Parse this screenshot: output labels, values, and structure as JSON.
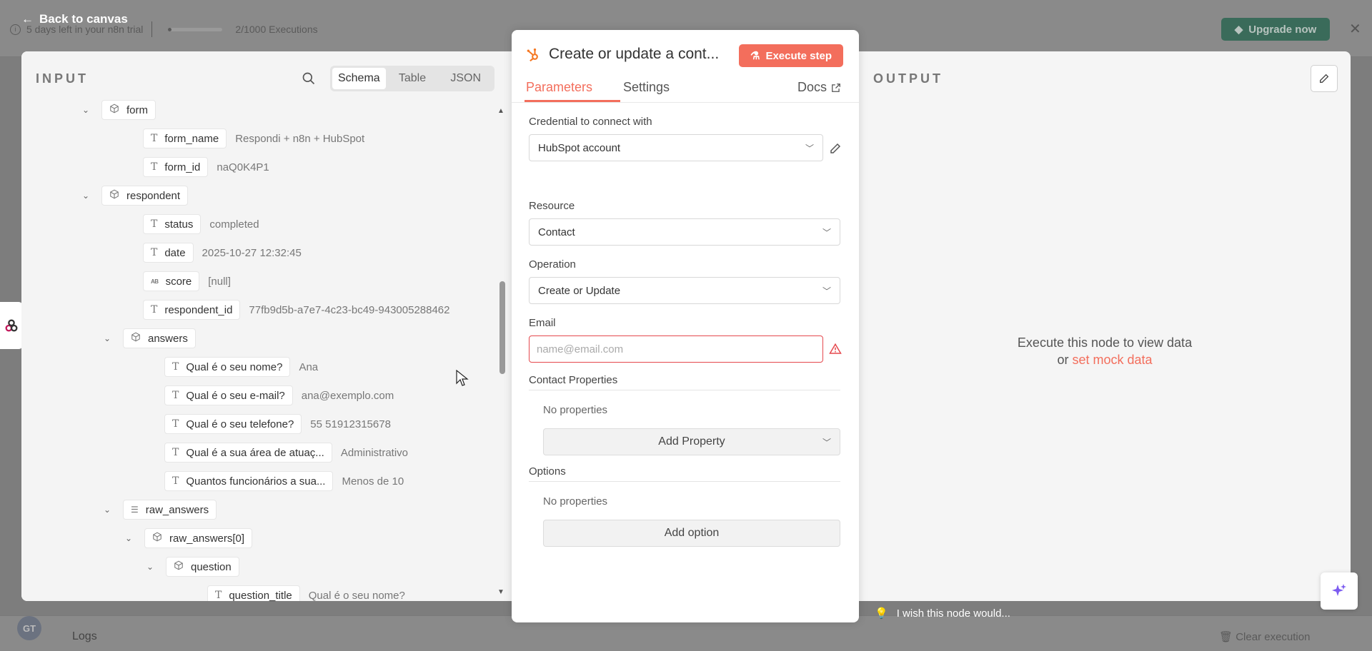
{
  "trial": {
    "text": "5 days left in your n8n trial",
    "executions": "2/1000 Executions",
    "progress": 0.002
  },
  "header": {
    "back_label": "Back to canvas",
    "upgrade_label": "Upgrade now"
  },
  "input_panel": {
    "title": "INPUT",
    "views": [
      "Schema",
      "Table",
      "JSON"
    ],
    "active_view": "Schema",
    "tree": [
      {
        "key": "form",
        "type": "object",
        "depth": 0,
        "expanded": true
      },
      {
        "key": "form_name",
        "type": "string",
        "depth": 1,
        "value": "Respondi + n8n + HubSpot"
      },
      {
        "key": "form_id",
        "type": "string",
        "depth": 1,
        "value": "naQ0K4P1"
      },
      {
        "key": "respondent",
        "type": "object",
        "depth": 0,
        "expanded": true
      },
      {
        "key": "status",
        "type": "string",
        "depth": 1,
        "value": "completed"
      },
      {
        "key": "date",
        "type": "string",
        "depth": 1,
        "value": "2025-10-27 12:32:45"
      },
      {
        "key": "score",
        "type": "null",
        "depth": 1,
        "value": "[null]"
      },
      {
        "key": "respondent_id",
        "type": "string",
        "depth": 1,
        "value": "77fb9d5b-a7e7-4c23-bc49-943005288462"
      },
      {
        "key": "answers",
        "type": "object",
        "depth": 1,
        "expanded": true
      },
      {
        "key": "Qual é o seu nome?",
        "type": "string",
        "depth": 2,
        "value": "Ana"
      },
      {
        "key": "Qual é o seu e-mail?",
        "type": "string",
        "depth": 2,
        "value": "ana@exemplo.com"
      },
      {
        "key": "Qual é o seu telefone?",
        "type": "string",
        "depth": 2,
        "value": "55 51912315678"
      },
      {
        "key": "Qual é a sua área de atuaç...",
        "type": "string",
        "depth": 2,
        "value": "Administrativo"
      },
      {
        "key": "Quantos funcionários a sua...",
        "type": "string",
        "depth": 2,
        "value": "Menos de 10"
      },
      {
        "key": "raw_answers",
        "type": "array",
        "depth": 1,
        "expanded": true
      },
      {
        "key": "raw_answers[0]",
        "type": "object",
        "depth": 2,
        "expanded": true
      },
      {
        "key": "question",
        "type": "object",
        "depth": 3,
        "expanded": true
      },
      {
        "key": "question_title",
        "type": "string",
        "depth": 4,
        "value": "Qual é o seu nome?"
      }
    ]
  },
  "node": {
    "title": "Create or update a cont...",
    "execute_label": "Execute step",
    "tabs": [
      "Parameters",
      "Settings"
    ],
    "active_tab": "Parameters",
    "docs_label": "Docs",
    "credential_label": "Credential to connect with",
    "credential_value": "HubSpot account",
    "resource_label": "Resource",
    "resource_value": "Contact",
    "operation_label": "Operation",
    "operation_value": "Create or Update",
    "email_label": "Email",
    "email_placeholder": "name@email.com",
    "contact_properties_label": "Contact Properties",
    "contact_properties_empty": "No properties",
    "add_property_label": "Add Property",
    "options_label": "Options",
    "options_empty": "No properties",
    "add_option_label": "Add option"
  },
  "output_panel": {
    "title": "OUTPUT",
    "message_line1": "Execute this node to view data",
    "message_or": "or",
    "mock_link": "set mock data"
  },
  "footer": {
    "wish_label": "I wish this node would...",
    "logs_label": "Logs",
    "clear_label": "Clear execution",
    "avatar_initials": "GT"
  },
  "colors": {
    "accent": "#f36e5c",
    "error": "#e5484d",
    "upgrade_bg": "#3a6b5a"
  }
}
